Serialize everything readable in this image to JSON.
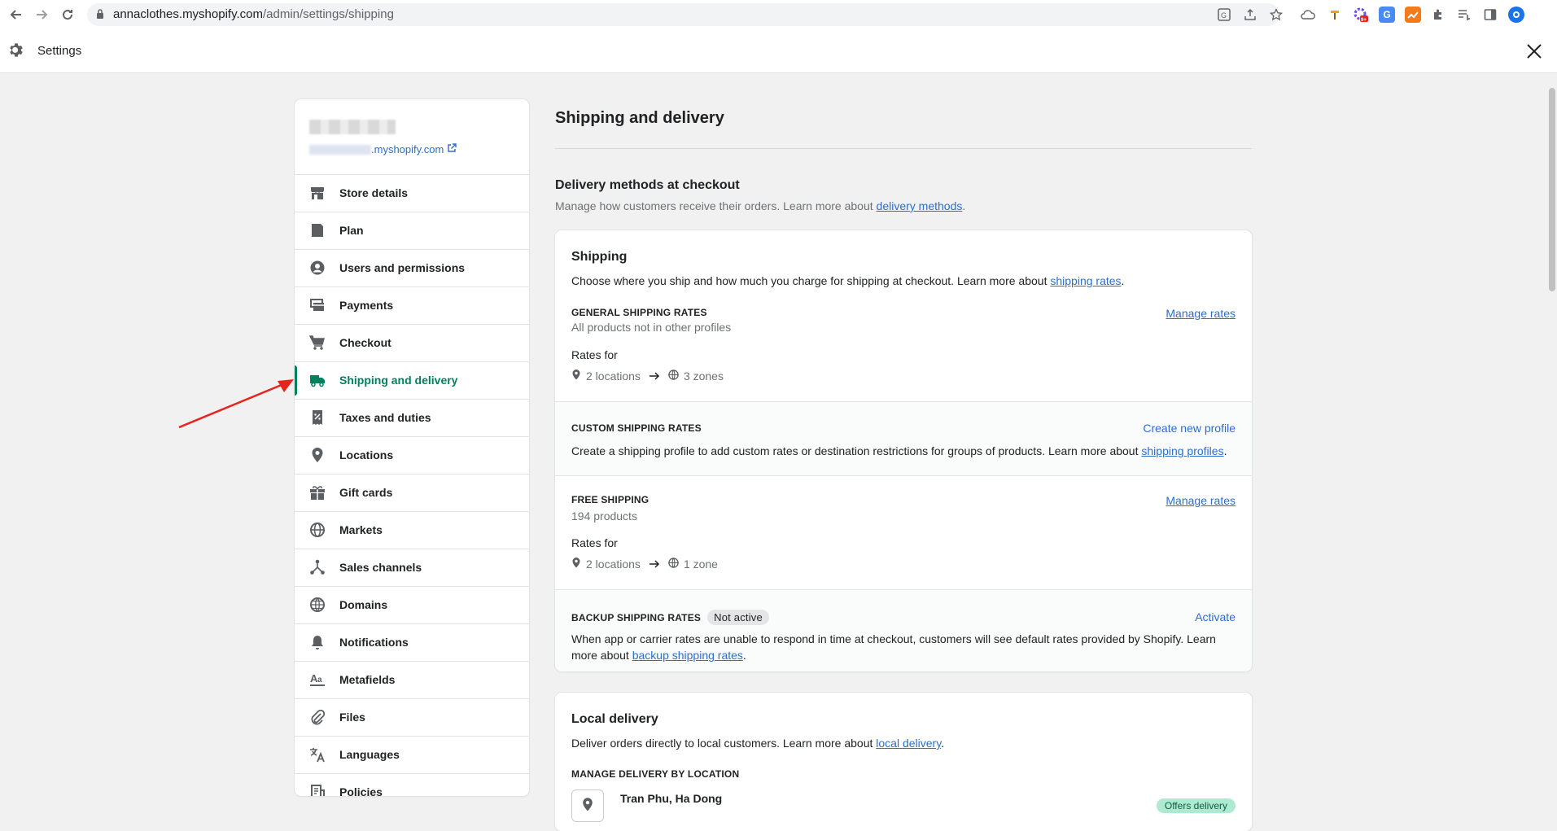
{
  "browser": {
    "url_host": "annaclothes.myshopify.com",
    "url_path": "/admin/settings/shipping"
  },
  "settings_bar": {
    "title": "Settings"
  },
  "sidebar": {
    "store_url_suffix": ".myshopify.com",
    "items": [
      {
        "label": "Store details",
        "icon": "store-icon"
      },
      {
        "label": "Plan",
        "icon": "plan-icon"
      },
      {
        "label": "Users and permissions",
        "icon": "user-icon"
      },
      {
        "label": "Payments",
        "icon": "payments-icon"
      },
      {
        "label": "Checkout",
        "icon": "cart-icon"
      },
      {
        "label": "Shipping and delivery",
        "icon": "truck-icon",
        "active": true
      },
      {
        "label": "Taxes and duties",
        "icon": "tax-icon"
      },
      {
        "label": "Locations",
        "icon": "location-icon"
      },
      {
        "label": "Gift cards",
        "icon": "gift-icon"
      },
      {
        "label": "Markets",
        "icon": "markets-icon"
      },
      {
        "label": "Sales channels",
        "icon": "channels-icon"
      },
      {
        "label": "Domains",
        "icon": "globe-icon"
      },
      {
        "label": "Notifications",
        "icon": "bell-icon"
      },
      {
        "label": "Metafields",
        "icon": "metafields-icon"
      },
      {
        "label": "Files",
        "icon": "paperclip-icon"
      },
      {
        "label": "Languages",
        "icon": "language-icon"
      },
      {
        "label": "Policies",
        "icon": "policies-icon"
      }
    ]
  },
  "main": {
    "title": "Shipping and delivery",
    "delivery_methods": {
      "title": "Delivery methods at checkout",
      "desc_prefix": "Manage how customers receive their orders. Learn more about ",
      "desc_link": "delivery methods",
      "desc_suffix": "."
    },
    "shipping_card": {
      "title": "Shipping",
      "desc_prefix": "Choose where you ship and how much you charge for shipping at checkout. Learn more about ",
      "desc_link": "shipping rates",
      "desc_suffix": ".",
      "general": {
        "heading": "GENERAL SHIPPING RATES",
        "sub": "All products not in other profiles",
        "action": "Manage rates",
        "rates_for": "Rates for",
        "locations": "2 locations",
        "zones": "3 zones"
      },
      "custom": {
        "heading": "CUSTOM SHIPPING RATES",
        "action": "Create new profile",
        "desc_prefix": "Create a shipping profile to add custom rates or destination restrictions for groups of products. Learn more about ",
        "desc_link": "shipping profiles",
        "desc_suffix": "."
      },
      "free": {
        "heading": "FREE SHIPPING",
        "sub": "194 products",
        "action": "Manage rates",
        "rates_for": "Rates for",
        "locations": "2 locations",
        "zones": "1 zone"
      },
      "backup": {
        "heading": "BACKUP SHIPPING RATES",
        "badge": "Not active",
        "action": "Activate",
        "desc_line1": "When app or carrier rates are unable to respond in time at checkout, customers will see default rates provided by Shopify. Learn",
        "desc_prefix": "more about ",
        "desc_link": "backup shipping rates",
        "desc_suffix": "."
      }
    },
    "local_delivery": {
      "title": "Local delivery",
      "desc_prefix": "Deliver orders directly to local customers. Learn more about ",
      "desc_link": "local delivery",
      "desc_suffix": ".",
      "manage_heading": "MANAGE DELIVERY BY LOCATION",
      "location_name": "Tran Phu, Ha Dong",
      "badge": "Offers delivery"
    }
  },
  "colors": {
    "accent_green": "#008060",
    "link_blue": "#2c6ecb",
    "annotation_red": "#e8231d"
  }
}
